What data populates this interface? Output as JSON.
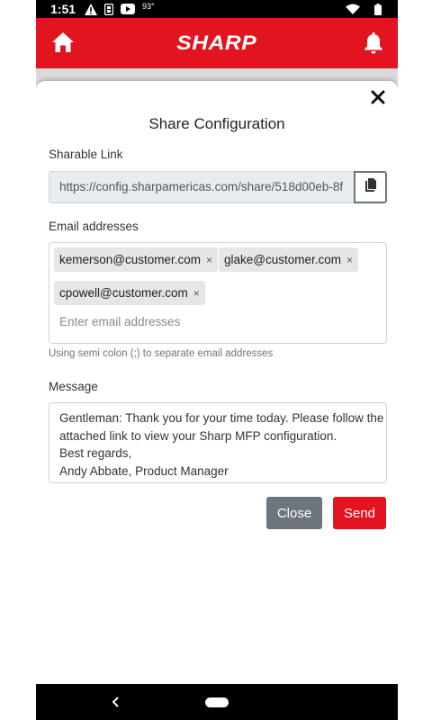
{
  "status_bar": {
    "time": "1:51",
    "temperature": "93°",
    "icons": [
      "warning-icon",
      "sim-card-icon",
      "youtube-icon",
      "wifi-icon",
      "battery-icon"
    ]
  },
  "header": {
    "logo_text": "SHARP",
    "brand_color": "#e2141f",
    "icons": [
      "home-icon",
      "bell-icon"
    ]
  },
  "modal": {
    "title": "Share Configuration",
    "sharable_link_label": "Sharable Link",
    "sharable_link_value": "https://config.sharpamericas.com/share/518d00eb-8f",
    "email_label": "Email addresses",
    "emails": [
      "kemerson@customer.com",
      "glake@customer.com",
      "cpowell@customer.com"
    ],
    "chip_remove": "×",
    "email_placeholder": "Enter email addresses",
    "email_hint": "Using semi colon (;) to separate email addresses",
    "message_label": "Message",
    "message_lines": [
      "Gentleman: Thank you for your time today. Please follow the",
      "attached link to view your Sharp MFP configuration.",
      "Best regards,",
      "Andy Abbate, Product Manager"
    ],
    "close_label": "Close",
    "send_label": "Send"
  }
}
